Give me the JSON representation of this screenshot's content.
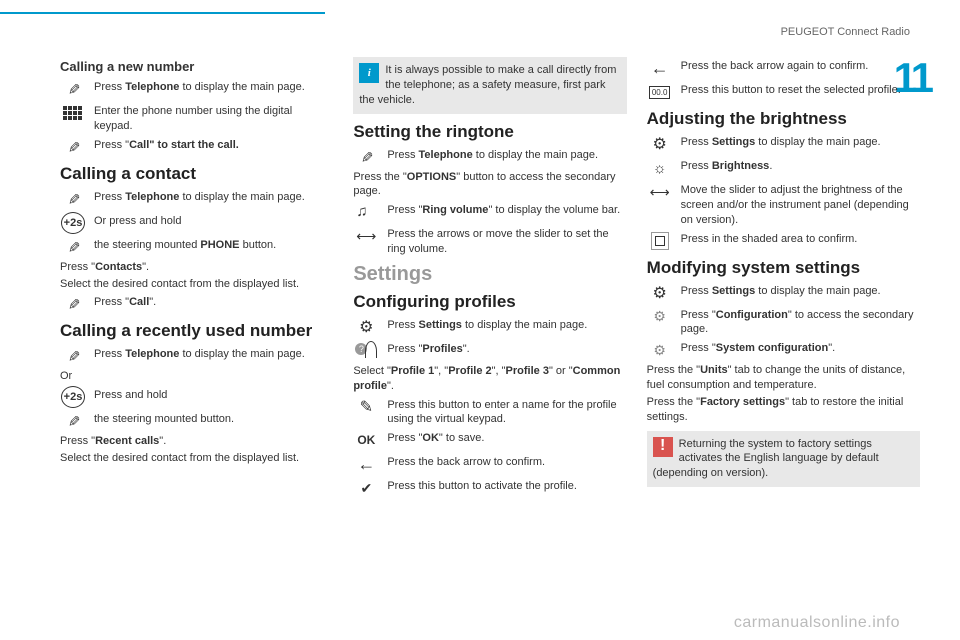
{
  "header": "PEUGEOT Connect Radio",
  "chapter": "11",
  "watermark": "carmanualsonline.info",
  "col1": {
    "h_newnum": "Calling a new number",
    "s1": "Press <b>Telephone</b> to display the main page.",
    "s2": "Enter the phone number using the digital keypad.",
    "s3": "Press \"<b>Call\" to start the call.</b>",
    "h_contact": "Calling a contact",
    "s4": "Press <b>Telephone</b> to display the main page.",
    "s5": "Or press and hold",
    "s6": "the steering mounted <b>PHONE</b> button.",
    "p1": "Press \"<b>Contacts</b>\".",
    "p2": "Select the desired contact from the displayed list.",
    "s7": "Press \"<b>Call</b>\".",
    "h_recent": "Calling a recently used number",
    "s8": "Press <b>Telephone</b> to display the main page.",
    "or": "Or",
    "s9": "Press and hold",
    "s10": "the steering mounted button.",
    "p3": "Press \"<b>Recent calls</b>\".",
    "p4": "Select the desired contact from the displayed list."
  },
  "col2": {
    "info": "It is always possible to make a call directly from the telephone; as a safety measure, first park the vehicle.",
    "h_ring": "Setting the ringtone",
    "s1": "Press <b>Telephone</b> to display the main page.",
    "p1": "Press the \"<b>OPTIONS</b>\" button to access the secondary page.",
    "s2": "Press \"<b>Ring volume</b>\" to display the volume bar.",
    "s3": "Press the arrows or move the slider to set the ring volume.",
    "h_settings": "Settings",
    "h_profiles": "Configuring profiles",
    "s4": "Press <b>Settings</b> to display the main page.",
    "s5": "Press \"<b>Profiles</b>\".",
    "p2": "Select \"<b>Profile 1</b>\", \"<b>Profile 2</b>\", \"<b>Profile 3</b>\" or \"<b>Common profile</b>\".",
    "s6": "Press this button to enter a name for the profile using the virtual keypad.",
    "s7": "Press \"<b>OK</b>\" to save.",
    "s8": "Press the back arrow to confirm.",
    "s9": "Press this button to activate the profile."
  },
  "col3": {
    "s1": "Press the back arrow again to confirm.",
    "s2": "Press this button to reset the selected profile.",
    "reset_label": "00.0",
    "h_bright": "Adjusting the brightness",
    "s3": "Press <b>Settings</b> to display the main page.",
    "s4": "Press <b>Brightness</b>.",
    "s5": "Move the slider to adjust the brightness of the screen and/or the instrument panel (depending on version).",
    "s6": "Press in the shaded area to confirm.",
    "h_mod": "Modifying system settings",
    "s7": "Press <b>Settings</b> to display the main page.",
    "s8": "Press \"<b>Configuration</b>\" to access the secondary page.",
    "s9": "Press \"<b>System configuration</b>\".",
    "p1": "Press the \"<b>Units</b>\" tab to change the units of distance, fuel consumption and temperature.",
    "p2": "Press the \"<b>Factory settings</b>\" tab to restore the initial settings.",
    "warn": "Returning the system to factory settings activates the English language by default (depending on version)."
  }
}
